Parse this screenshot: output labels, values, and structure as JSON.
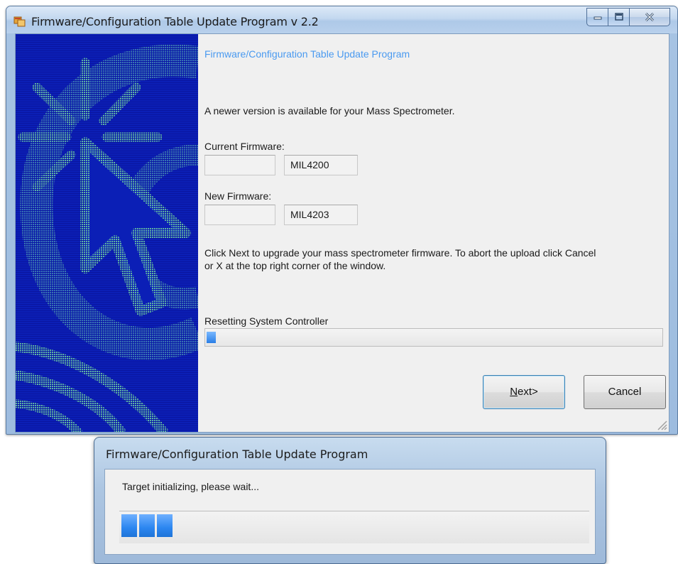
{
  "main_window": {
    "title": "Firmware/Configuration Table Update Program v 2.2",
    "heading": "Firmware/Configuration Table Update Program",
    "message": "A newer version is available for your Mass Spectrometer.",
    "current_label": "Current  Firmware:",
    "current_left_value": "",
    "current_value": "MIL4200",
    "new_label": "New Firmware:",
    "new_left_value": "",
    "new_value": "MIL4203",
    "instructions_line1": "Click Next to upgrade your mass spectrometer firmware. To abort the upload click Cancel",
    "instructions_line2": "or X at the top right corner of the window.",
    "status": "Resetting System Controller",
    "progress_fraction": 0.02,
    "next_prefix": "",
    "next_underlined": "N",
    "next_suffix": "ext>",
    "cancel_label": "Cancel",
    "accent_color": "#4a9af0"
  },
  "dialog": {
    "title": "Firmware/Configuration Table Update Program",
    "message": "Target initializing, please wait...",
    "progress_blocks_lit": 3
  },
  "icons": {
    "app": "app-icon",
    "minimize": "minimize-icon",
    "maximize": "maximize-icon",
    "close": "close-icon",
    "grip": "resize-grip-icon"
  }
}
